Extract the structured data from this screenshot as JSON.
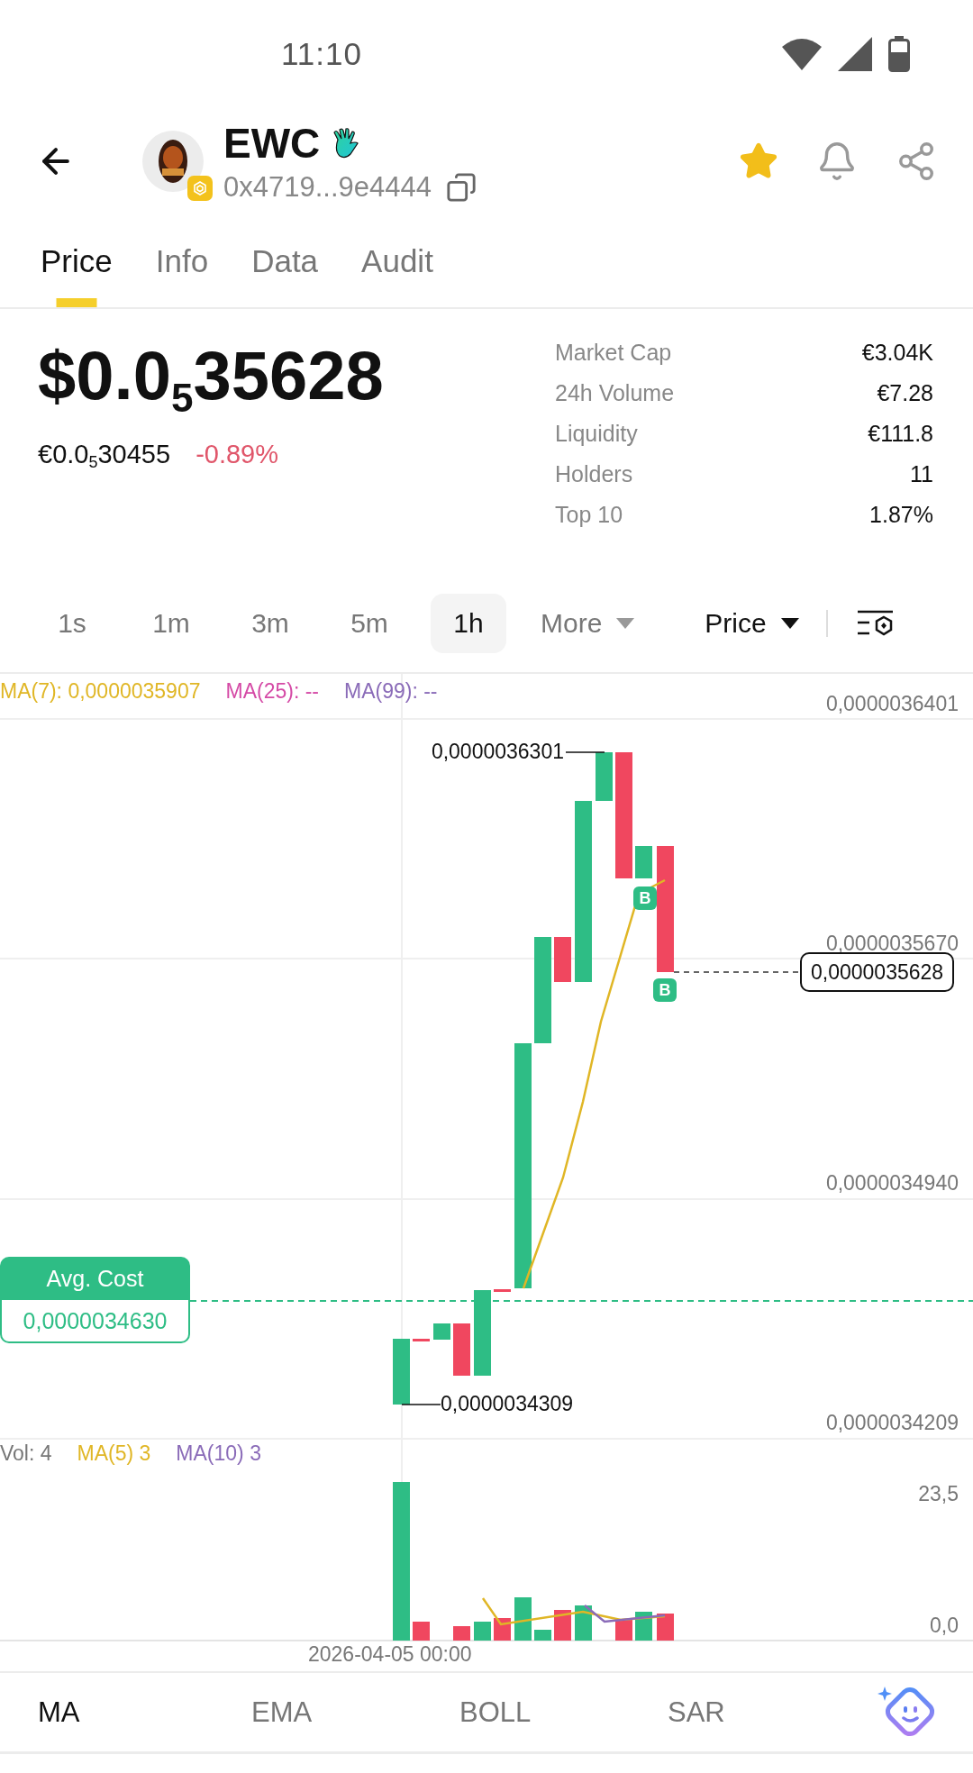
{
  "status_bar": {
    "time": "11:10"
  },
  "token": {
    "symbol": "EWC",
    "address": "0x4719...9e4444",
    "favorite": true
  },
  "tabs": [
    {
      "label": "Price",
      "selected": true
    },
    {
      "label": "Info",
      "selected": false
    },
    {
      "label": "Data",
      "selected": false
    },
    {
      "label": "Audit",
      "selected": false
    }
  ],
  "price": {
    "usd": "$0.0$_{5}$35628",
    "eur": "€0.0$_{5}$30455",
    "change": "-0.89%"
  },
  "stats": [
    {
      "label": "Market Cap",
      "value": "€3.04K"
    },
    {
      "label": "24h Volume",
      "value": "€7.28"
    },
    {
      "label": "Liquidity",
      "value": "€111.8"
    },
    {
      "label": "Holders",
      "value": "11"
    },
    {
      "label": "Top 10",
      "value": "1.87%"
    }
  ],
  "timeframes": [
    {
      "label": "1s",
      "selected": false
    },
    {
      "label": "1m",
      "selected": false
    },
    {
      "label": "3m",
      "selected": false
    },
    {
      "label": "5m",
      "selected": false
    },
    {
      "label": "1h",
      "selected": true
    }
  ],
  "more": "More",
  "price_mode": "Price",
  "chart": {
    "ma_legend": [
      {
        "label": "MA(7): 0,0000035907",
        "color": "#e0b625"
      },
      {
        "label": "MA(25): --",
        "color": "#d54aa6"
      },
      {
        "label": "MA(99): --",
        "color": "#8a6bb8"
      }
    ],
    "axis_labels": [
      "0,0000036401",
      "0,0000035670",
      "0,0000034940",
      "0,0000034209"
    ],
    "high": "0,0000036301",
    "low": "0,0000034309",
    "current": "0,0000035628",
    "markers": [
      "B",
      "B"
    ],
    "avg_cost": {
      "title": "Avg. Cost",
      "value": "0,0000034630"
    },
    "volume_legend": [
      {
        "label": "Vol: 4",
        "color": "#777777"
      },
      {
        "label": "MA(5) 3",
        "color": "#e0b625"
      },
      {
        "label": "MA(10) 3",
        "color": "#8a6bb8"
      }
    ],
    "volume_axis": [
      "23,5",
      "0,0"
    ],
    "date": "2026-04-05 00:00"
  },
  "indicators": [
    {
      "label": "MA",
      "selected": true
    },
    {
      "label": "EMA",
      "selected": false
    },
    {
      "label": "BOLL",
      "selected": false
    },
    {
      "label": "SAR",
      "selected": false
    }
  ]
}
